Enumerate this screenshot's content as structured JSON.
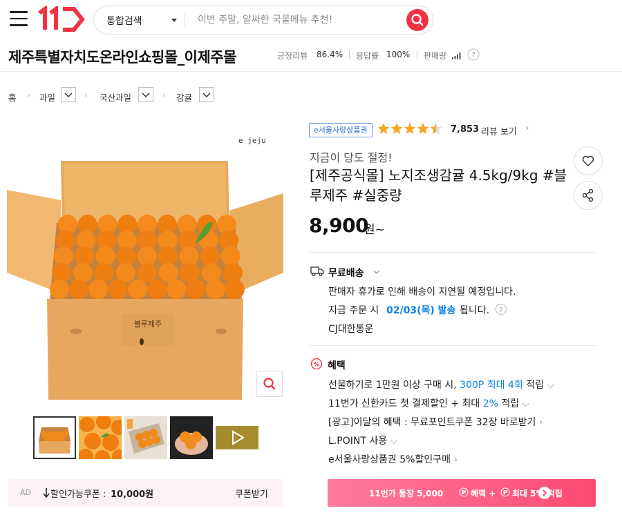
{
  "header": {
    "search_type": "통합검색",
    "search_placeholder": "이번 주말, 알싸한 국물메뉴 추천!"
  },
  "store": {
    "name": "제주특별자치도온라인쇼핑몰_이제주몰",
    "positive_review_label": "긍정리뷰",
    "positive_review_value": "86.4%",
    "response_label": "응답률",
    "response_value": "100%",
    "sales_label": "판매량"
  },
  "breadcrumb": [
    "홈",
    "과일",
    "국산과일",
    "감귤"
  ],
  "product": {
    "tag": "e서울사랑상품권",
    "rating": 4.5,
    "review_count": "7,853",
    "review_label": "리뷰 보기",
    "subtitle": "지금이 당도 절정!",
    "title": "[제주공식몰] 노지조생감귤 4.5kg/9kg #블루제주 #실중량",
    "price": "8,900",
    "price_unit": "원~",
    "image_watermark": "e jeju",
    "box_label": "블루제주"
  },
  "shipping": {
    "title": "무료배송",
    "notice": "판매자 휴가로 인해 배송이 지연될 예정입니다.",
    "order_prefix": "지금 주문 시",
    "order_date": "02/03(목) 발송",
    "order_suffix": "됩니다.",
    "carrier": "CJ대한통운"
  },
  "benefits": {
    "title": "혜택",
    "items": [
      {
        "pre": "선물하기로 1만원 이상 구매 시,",
        "highlight": "300P 최대 4회",
        "post": "적립"
      },
      {
        "pre": "11번가 신한카드 첫 결제할인 + 최대",
        "highlight": "2%",
        "post": "적립"
      },
      {
        "pre": "[광고]이달의 혜택 : 무료포인트쿠폰 32장 바로받기",
        "highlight": "",
        "post": ""
      },
      {
        "pre": "L.POINT 사용",
        "highlight": "",
        "post": ""
      },
      {
        "pre": "e서울사랑상품권 5%할인구매",
        "highlight": "",
        "post": ""
      }
    ]
  },
  "coupon": {
    "ad_label": "AD",
    "text_prefix": "할인가능쿠폰 :",
    "amount": "10,000원",
    "button": "쿠폰받기"
  },
  "pay_banner": {
    "text1": "11번가 통장 5,000",
    "text2": "혜택 +",
    "text3": "최대 5% 적립"
  },
  "colors": {
    "brand": "#f43142",
    "blue": "#0b83e6",
    "star": "#f5a623"
  }
}
